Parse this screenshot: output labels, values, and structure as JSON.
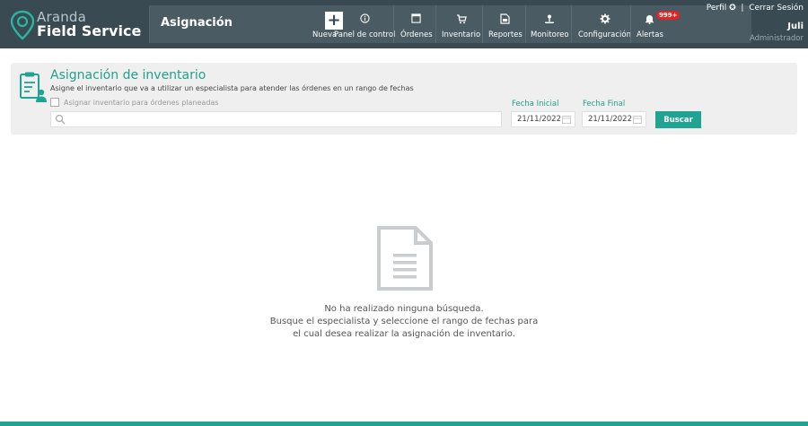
{
  "header": {
    "logo_top": "Aranda",
    "logo_bottom": "Field Service",
    "section_title": "Asignación",
    "nav": [
      {
        "label": "Nueva",
        "icon": "plus-icon"
      },
      {
        "label": "Panel de control",
        "icon": "info-circle-icon"
      },
      {
        "label": "Órdenes",
        "icon": "window-icon"
      },
      {
        "label": "Inventario",
        "icon": "cart-icon"
      },
      {
        "label": "Reportes",
        "icon": "report-icon"
      },
      {
        "label": "Monitoreo",
        "icon": "map-pin-icon"
      },
      {
        "label": "Configuración",
        "icon": "gear-icon"
      },
      {
        "label": "Alertas",
        "icon": "bell-icon"
      }
    ],
    "alert_badge": "999+",
    "profile_label": "Perfil",
    "logout_label": "Cerrar Sesión",
    "separator": "|",
    "user_name": "Juli",
    "user_role": "Administrador"
  },
  "panel": {
    "title": "Asignación de inventario",
    "subtitle": "Asigne el inventario que va a utilizar un especialista para atender las órdenes en un rango de fechas",
    "checkbox_label": "Asignar inventario para órdenes planeadas",
    "search_placeholder": "",
    "start_date_label": "Fecha Inicial",
    "start_date_value": "21/11/2022",
    "end_date_label": "Fecha Final",
    "end_date_value": "21/11/2022",
    "search_button": "Buscar"
  },
  "empty_state": {
    "line1": "No ha realizado ninguna búsqueda.",
    "line2": "Busque el especialista y seleccione el rango de fechas para",
    "line3": "el cual desea realizar la asignación de inventario."
  },
  "colors": {
    "header_bg": "#3a4a52",
    "accent": "#1fa393",
    "badge": "#e02424"
  }
}
